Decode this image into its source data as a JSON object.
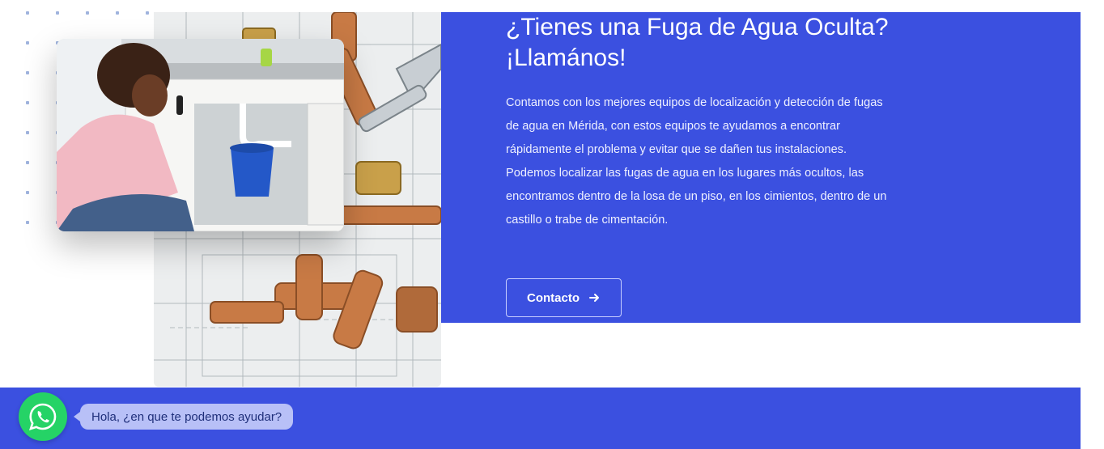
{
  "section": {
    "heading_line1": "¿Tienes una Fuga de Agua Oculta?",
    "heading_line2": "¡Llamános!",
    "description_lines": [
      "Contamos con los mejores equipos de localización y detección de fugas",
      "de agua en Mérida, con estos equipos te ayudamos  a encontrar",
      "rápidamente el problema y evitar que se dañen tus instalaciones.",
      "Podemos localizar las fugas de agua en los lugares más ocultos, las",
      "encontramos dentro de la losa de un piso, en los cimientos, dentro de un",
      "castillo o trabe de cimentación."
    ],
    "button_label": "Contacto",
    "button_icon": "arrow-right-icon"
  },
  "images": {
    "pipes": "copper-pipe-fittings-on-blueprint",
    "woman": "woman-on-phone-checking-sink-leak"
  },
  "whatsapp": {
    "icon": "whatsapp-icon",
    "bubble_text": "Hola, ¿en que te podemos ayudar?"
  },
  "colors": {
    "panel": "#3b50e0",
    "whatsapp": "#25d366",
    "bubble": "#b8c0f7"
  }
}
